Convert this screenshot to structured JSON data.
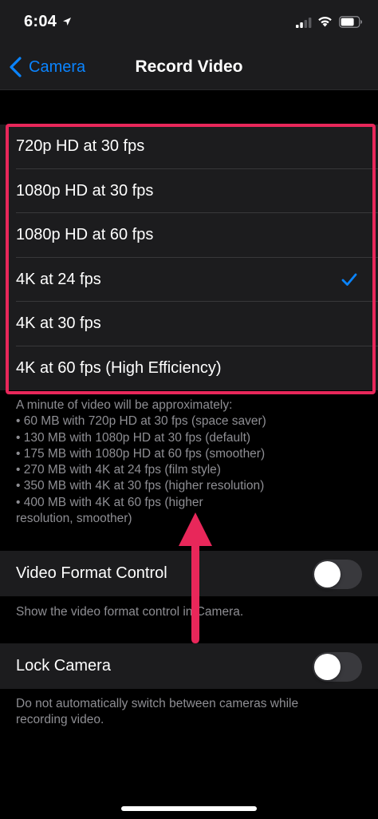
{
  "status_bar": {
    "time": "6:04"
  },
  "nav": {
    "back_label": "Camera",
    "title": "Record Video"
  },
  "options": [
    {
      "label": "720p HD at 30 fps",
      "selected": false
    },
    {
      "label": "1080p HD at 30 fps",
      "selected": false
    },
    {
      "label": "1080p HD at 60 fps",
      "selected": false
    },
    {
      "label": "4K at 24 fps",
      "selected": true
    },
    {
      "label": "4K at 30 fps",
      "selected": false
    },
    {
      "label": "4K at 60 fps (High Efficiency)",
      "selected": false
    }
  ],
  "footnote": {
    "lines": [
      "A minute of video will be approximately:",
      "• 60 MB with 720p HD at 30 fps (space saver)",
      "• 130 MB with 1080p HD at 30 fps (default)",
      "• 175 MB with 1080p HD at 60 fps (smoother)",
      "• 270 MB with 4K at 24 fps (film style)",
      "• 350 MB with 4K at 30 fps (higher resolution)",
      "• 400 MB with 4K at 60 fps (higher",
      "resolution, smoother)"
    ]
  },
  "video_format_control": {
    "label": "Video Format Control",
    "enabled": false,
    "description": "Show the video format control in Camera."
  },
  "lock_camera": {
    "label": "Lock Camera",
    "enabled": false,
    "description_lines": [
      "Do not automatically switch between cameras while",
      "recording video."
    ]
  },
  "colors": {
    "accent": "#0a84ff",
    "annotation": "#e8275a",
    "background": "#000000",
    "cell": "#1c1c1e",
    "secondary_text": "#8e8e93"
  },
  "icons": {
    "back": "chevron-left-icon",
    "selected": "checkmark-icon",
    "location": "location-arrow-icon",
    "signal": "cellular-signal-icon",
    "wifi": "wifi-icon",
    "battery": "battery-icon",
    "annotation": "arrow-up-icon"
  }
}
